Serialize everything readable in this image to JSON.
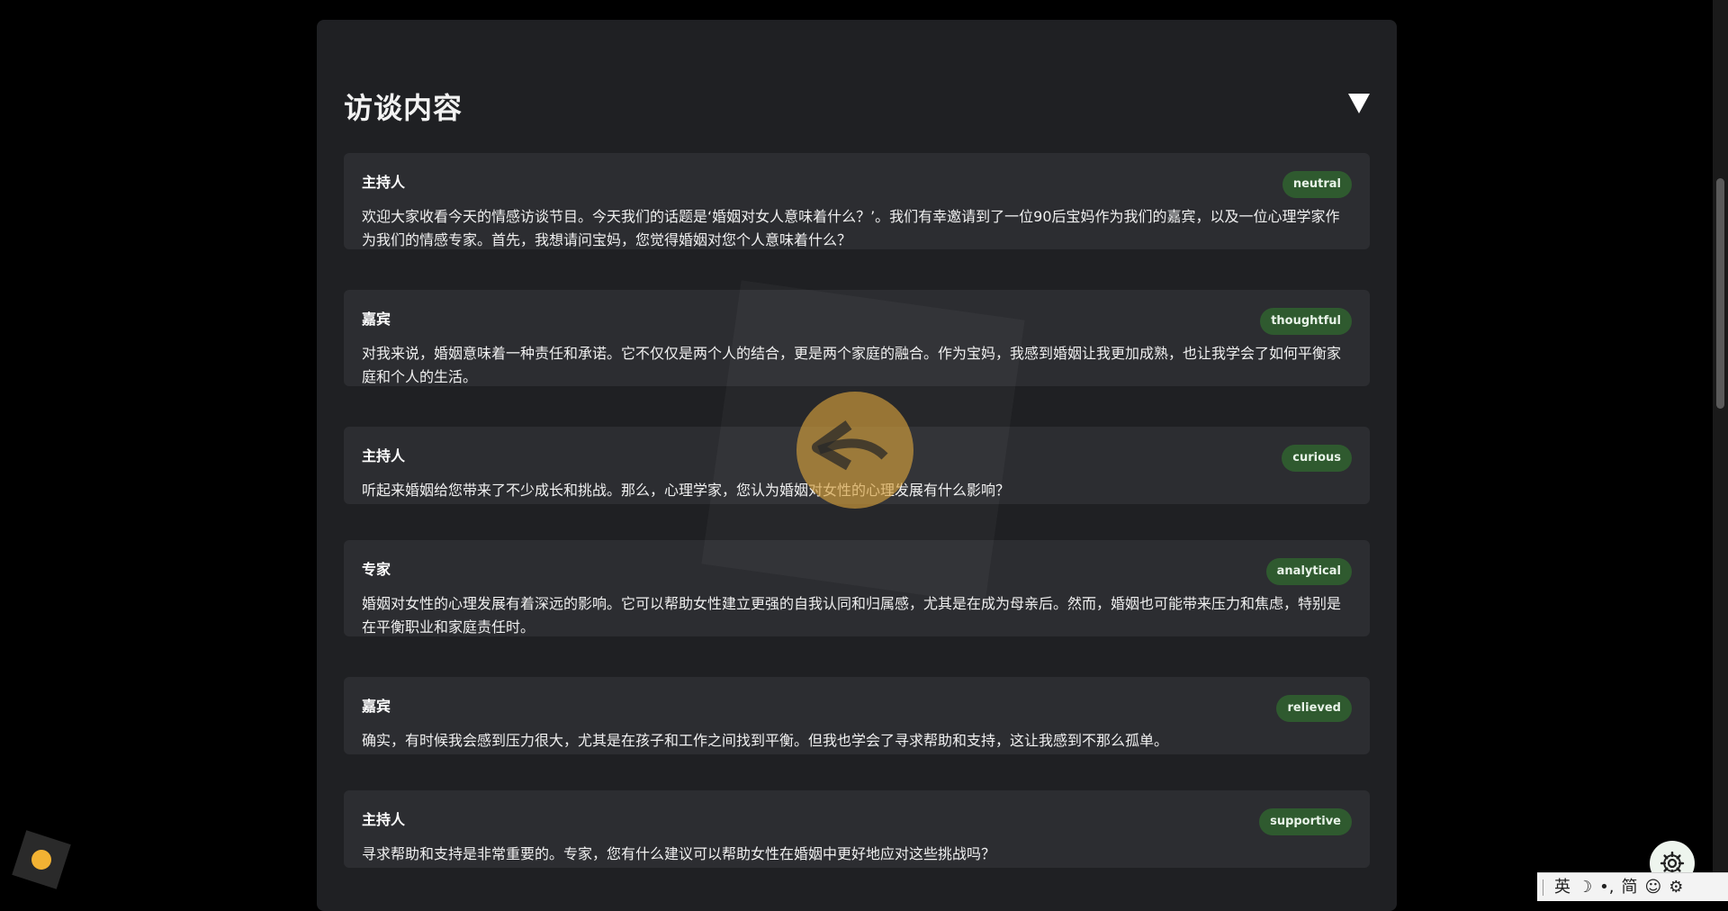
{
  "section": {
    "title": "访谈内容",
    "toggle_icon": "collapse-triangle-icon"
  },
  "dialogue": [
    {
      "speaker": "主持人",
      "tone": "neutral",
      "text": "欢迎大家收看今天的情感访谈节目。今天我们的话题是‘婚姻对女人意味着什么？’。我们有幸邀请到了一位90后宝妈作为我们的嘉宾，以及一位心理学家作为我们的情感专家。首先，我想请问宝妈，您觉得婚姻对您个人意味着什么？"
    },
    {
      "speaker": "嘉宾",
      "tone": "thoughtful",
      "text": "对我来说，婚姻意味着一种责任和承诺。它不仅仅是两个人的结合，更是两个家庭的融合。作为宝妈，我感到婚姻让我更加成熟，也让我学会了如何平衡家庭和个人的生活。"
    },
    {
      "speaker": "主持人",
      "tone": "curious",
      "text": "听起来婚姻给您带来了不少成长和挑战。那么，心理学家，您认为婚姻对女性的心理发展有什么影响？"
    },
    {
      "speaker": "专家",
      "tone": "analytical",
      "text": "婚姻对女性的心理发展有着深远的影响。它可以帮助女性建立更强的自我认同和归属感，尤其是在成为母亲后。然而，婚姻也可能带来压力和焦虑，特别是在平衡职业和家庭责任时。"
    },
    {
      "speaker": "嘉宾",
      "tone": "relieved",
      "text": "确实，有时候我会感到压力很大，尤其是在孩子和工作之间找到平衡。但我也学会了寻求帮助和支持，这让我感到不那么孤单。"
    },
    {
      "speaker": "主持人",
      "tone": "supportive",
      "text": "寻求帮助和支持是非常重要的。专家，您有什么建议可以帮助女性在婚姻中更好地应对这些挑战吗？"
    }
  ],
  "ime": {
    "lang": "英",
    "moon": "☽",
    "punct": "•,",
    "script": "简",
    "emoji": "☺",
    "gear": "⚙"
  },
  "colors": {
    "badge_bg": "#2f5a2f",
    "card_bg": "#2c2d31",
    "panel_bg": "#1f2023",
    "watermark_accent": "#d6a03c"
  }
}
